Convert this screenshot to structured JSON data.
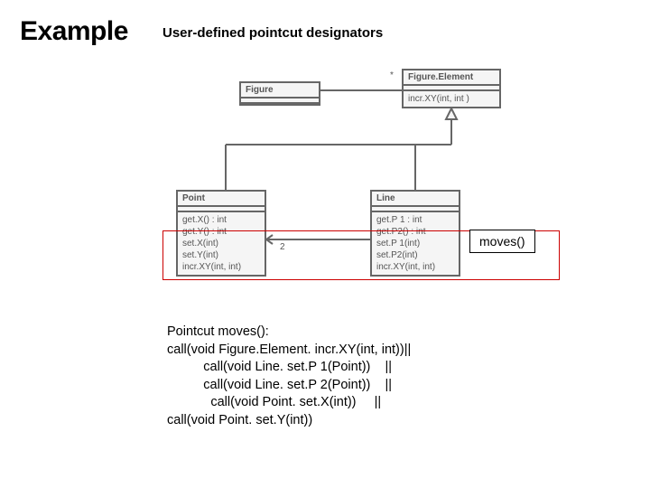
{
  "title": "Example",
  "subtitle": "User-defined pointcut designators",
  "uml": {
    "figure": {
      "name": "Figure"
    },
    "figureElement": {
      "name": "Figure.Element",
      "methods": [
        "incr.XY(int, int )"
      ]
    },
    "point": {
      "name": "Point",
      "methods": [
        "get.X() : int",
        "get.Y() : int",
        "set.X(int)",
        "set.Y(int)",
        "incr.XY(int, int)"
      ]
    },
    "line": {
      "name": "Line",
      "methods": [
        "get.P 1 : int",
        "get.P2() : int",
        "set.P 1(int)",
        "set.P2(int)",
        "incr.XY(int, int)"
      ]
    },
    "mult_star": "*",
    "mult_two": "2"
  },
  "callout": "moves()",
  "code": {
    "l1": "Pointcut moves():",
    "l2": "call(void Figure.Element. incr.XY(int, int))||",
    "l3": "          call(void Line. set.P 1(Point))    ||",
    "l4": "          call(void Line. set.P 2(Point))    ||",
    "l5": "            call(void Point. set.X(int))     ||",
    "l6": "call(void Point. set.Y(int))"
  }
}
